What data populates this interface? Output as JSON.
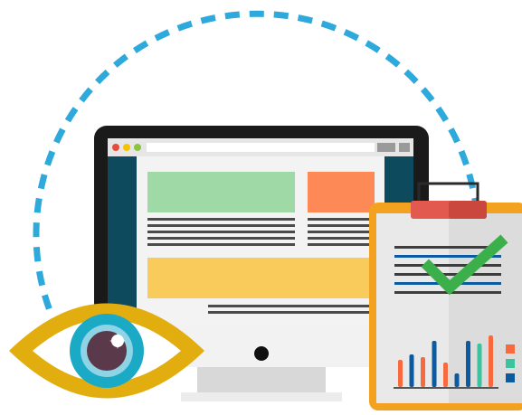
{
  "colors": {
    "orbit": "#2ea9dc",
    "monitor_bezel": "#1a1a1a",
    "browser_bar": "#e6e6e6",
    "sidebar": "#0e4a5e",
    "page": "#f3f3f3",
    "block_green": "#9ed9a6",
    "block_orange": "#fd8a56",
    "block_yellow": "#f9cb5b",
    "text_lines": "#4b4b4b",
    "stand": "#d8d8d8",
    "eye_outer": "#e1ad0f",
    "iris": "#1aaac6",
    "pupil": "#5a3a4a",
    "clipboard_frame": "#f3a21f",
    "clipboard_paper": "#dcdcdc",
    "clip": "#e25a4f",
    "checkmark": "#3bb04a"
  },
  "icons": {
    "orbit": "dashed-orbit-icon",
    "monitor": "monitor-icon",
    "eye": "eye-icon",
    "clipboard": "clipboard-icon",
    "check": "checkmark-icon",
    "chart": "bar-chart-icon"
  },
  "clipboard_chart": {
    "bars": [
      {
        "color": "#f86a3d",
        "value": 0.5
      },
      {
        "color": "#0c5aa0",
        "value": 0.6
      },
      {
        "color": "#f86a3d",
        "value": 0.55
      },
      {
        "color": "#0c5aa0",
        "value": 0.85
      },
      {
        "color": "#f86a3d",
        "value": 0.45
      },
      {
        "color": "#0c5aa0",
        "value": 0.25
      },
      {
        "color": "#0c5aa0",
        "value": 0.85
      },
      {
        "color": "#3bc3a0",
        "value": 0.8
      },
      {
        "color": "#f86a3d",
        "value": 0.95
      }
    ],
    "legend": [
      "#f86a3d",
      "#3bc3a0",
      "#0c5aa0"
    ]
  }
}
